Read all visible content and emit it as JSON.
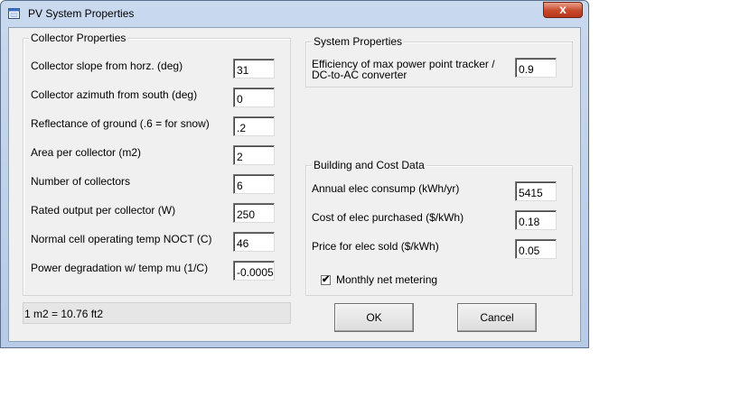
{
  "window": {
    "title": "PV System Properties",
    "close_symbol": "x"
  },
  "collector": {
    "legend": "Collector Properties",
    "rows": [
      {
        "label": "Collector slope from horz.  (deg)",
        "value": "31"
      },
      {
        "label": "Collector azimuth from south (deg)",
        "value": "0"
      },
      {
        "label": "Reflectance of ground (.6 = for snow)",
        "value": ".2"
      },
      {
        "label": "Area per collector (m2)",
        "value": "2"
      },
      {
        "label": "Number of collectors",
        "value": "6"
      },
      {
        "label": "Rated output per collector (W)",
        "value": "250"
      },
      {
        "label": "Normal cell operating temp NOCT (C)",
        "value": "46"
      },
      {
        "label": "Power degradation w/ temp mu (1/C)",
        "value": "-0.0005"
      }
    ]
  },
  "note": "1 m2 = 10.76 ft2",
  "system": {
    "legend": "System Properties",
    "label_line1": "Efficiency of max power point tracker /",
    "label_line2": "DC-to-AC converter",
    "value": "0.9"
  },
  "building": {
    "legend": "Building and Cost Data",
    "rows": [
      {
        "label": "Annual elec consump (kWh/yr)",
        "value": "5415"
      },
      {
        "label": "Cost of elec purchased ($/kWh)",
        "value": "0.18"
      },
      {
        "label": "Price for elec sold ($/kWh)",
        "value": "0.05"
      }
    ],
    "checkbox_label": "Monthly net metering",
    "checkbox_checked": true,
    "check_mark": "✔"
  },
  "buttons": {
    "ok": "OK",
    "cancel": "Cancel"
  },
  "icons": {
    "app": "window-app-icon",
    "close": "close-icon"
  }
}
